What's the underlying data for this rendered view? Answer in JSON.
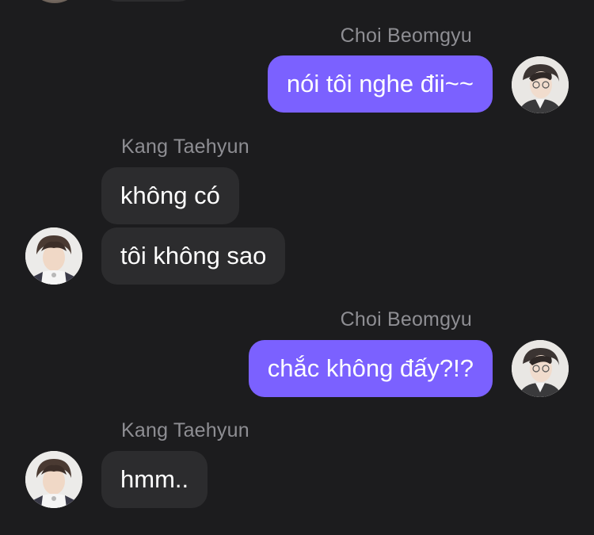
{
  "messages": [
    {
      "sender": "Choi Beomgyu",
      "side": "outgoing",
      "text": "nói tôi nghe đii~~"
    },
    {
      "sender": "Kang Taehyun",
      "side": "incoming",
      "texts": [
        "không có",
        "tôi không sao"
      ]
    },
    {
      "sender": "Choi Beomgyu",
      "side": "outgoing",
      "text": "chắc không đấy?!?"
    },
    {
      "sender": "Kang Taehyun",
      "side": "incoming",
      "text": "hmm.."
    }
  ],
  "colors": {
    "background": "#1c1c1e",
    "outgoing_bubble": "#7b61ff",
    "incoming_bubble": "#2c2c2e",
    "sender_name": "#8e8e93",
    "text": "#ffffff"
  },
  "icons": {
    "beomgyu_avatar": "avatar-beomgyu",
    "taehyun_avatar": "avatar-taehyun"
  }
}
